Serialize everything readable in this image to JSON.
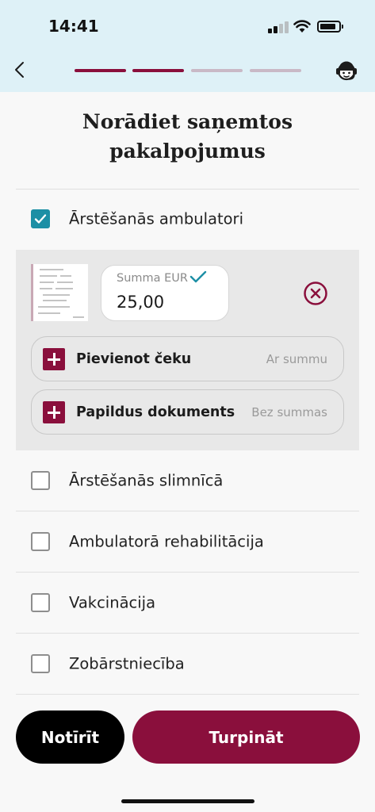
{
  "status_bar": {
    "time": "14:41"
  },
  "header": {
    "steps": [
      {
        "state": "done"
      },
      {
        "state": "done"
      },
      {
        "state": "todo"
      },
      {
        "state": "todo"
      }
    ]
  },
  "colors": {
    "brand": "#8a0f3c",
    "step_done": "#8a0f3c",
    "step_todo": "#c9b9c6",
    "checkbox_checked": "#1d8fa5",
    "header_bg": "#def1f7"
  },
  "title": {
    "line1": "Norādiet saņemtos",
    "line2": "pakalpojumus"
  },
  "categories": [
    {
      "label": "Ārstēšanās ambulatori",
      "checked": true
    },
    {
      "label": "Ārstēšanās slimnīcā",
      "checked": false
    },
    {
      "label": "Ambulatorā rehabilitācija",
      "checked": false
    },
    {
      "label": "Vakcinācija",
      "checked": false
    },
    {
      "label": "Zobārstniecība",
      "checked": false
    }
  ],
  "receipt": {
    "amount_label": "Summa EUR",
    "amount_value": "25,00"
  },
  "actions": {
    "add_receipt": {
      "label": "Pievienot čeku",
      "hint": "Ar summu"
    },
    "extra_document": {
      "label": "Papildus dokuments",
      "hint": "Bez summas"
    }
  },
  "footer": {
    "clear_label": "Notīrīt",
    "continue_label": "Turpināt"
  },
  "icons": {
    "back": "chevron-left-icon",
    "support": "support-agent-icon",
    "remove": "circle-x-icon",
    "add": "plus-icon",
    "check": "checkmark-icon"
  }
}
